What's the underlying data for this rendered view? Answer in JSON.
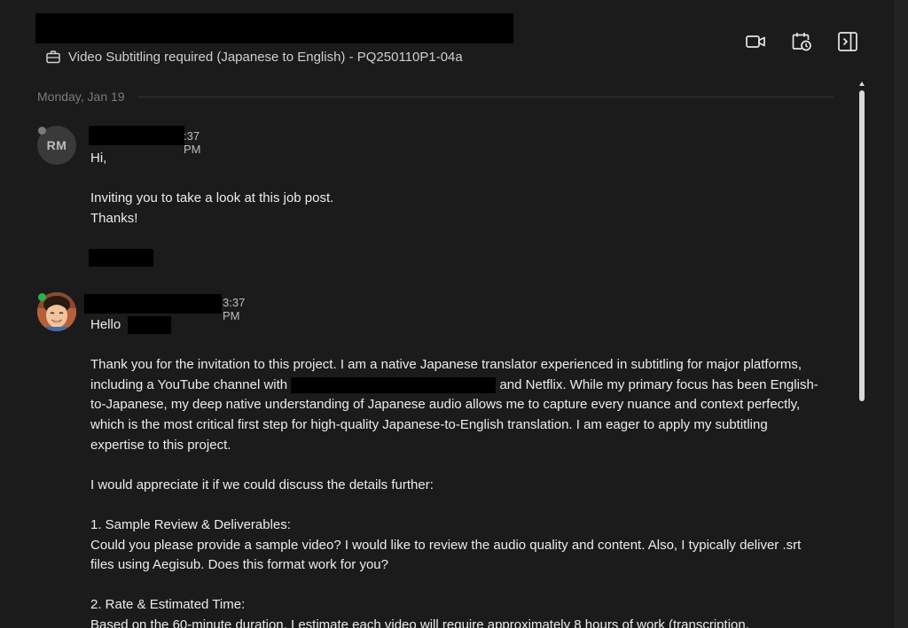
{
  "header": {
    "job_title": "Video Subtitling required (Japanese to English) - PQ250110P1-04a",
    "actions": [
      "video-call",
      "schedule",
      "toggle-sidebar"
    ]
  },
  "date_divider": "Monday, Jan 19",
  "messages": [
    {
      "avatar_initials": "RM",
      "status": "offline",
      "time": "3:37 PM",
      "time_visible": ":37 PM",
      "lines": {
        "l1": "Hi,",
        "l2": "Inviting you to take a look at this job post.",
        "l3": "Thanks!"
      }
    },
    {
      "avatar_icon": "user-photo",
      "status": "online",
      "time": "3:37 PM",
      "greeting": "Hello",
      "p1a": "Thank you for the invitation to this project. I am a native Japanese translator experienced in subtitling for major platforms,",
      "p1b_pre": "including a YouTube channel with",
      "p1b_post": "and Netflix. While my primary focus has been English-",
      "p1c": "to-Japanese, my deep native understanding of Japanese audio allows me to capture every nuance and context perfectly,",
      "p1d": "which is the most critical first step for high-quality Japanese-to-English translation. I am eager to apply my subtitling",
      "p1e": "expertise to this project.",
      "p2": "I would appreciate it if we could discuss the details further:",
      "s1_title": "1. Sample Review & Deliverables:",
      "s1a": "Could you please provide a sample video? I would like to review the audio quality and content. Also, I typically deliver .srt",
      "s1b": "files using Aegisub. Does this format work for you?",
      "s2_title": "2. Rate & Estimated Time:",
      "s2a": "Based on the 60-minute duration, I estimate each video will require approximately 8 hours of work (transcription,"
    }
  ]
}
